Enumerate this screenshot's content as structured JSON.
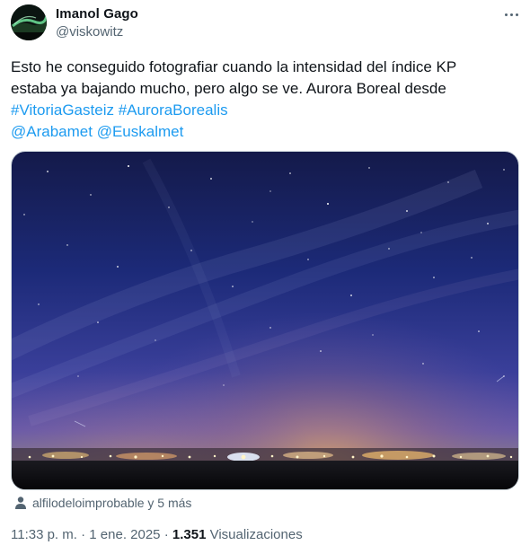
{
  "author": {
    "name": "Imanol Gago",
    "handle": "@viskowitz",
    "avatar_icon": "aurora-avatar"
  },
  "more_icon": "more-horizontal-icon",
  "tweet": {
    "line1": "Esto he conseguido fotografiar cuando la intensidad del índice KP",
    "line2": "estaba ya bajando mucho, pero algo se ve. Aurora Boreal desde",
    "hashtags": [
      "#VitoriaGasteiz",
      "#AuroraBorealis"
    ],
    "mentions": [
      "@Arabamet",
      "@Euskalmet"
    ]
  },
  "media": {
    "description_icon": "night-sky-aurora-photo"
  },
  "tagged": {
    "icon": "user-icon",
    "label": "alfilodeloimprobable y 5 más"
  },
  "meta": {
    "time": "11:33 p. m.",
    "separator": "·",
    "date": "1 ene. 2025",
    "views_count": "1.351",
    "views_label": "Visualizaciones"
  },
  "colors": {
    "link": "#1d9bf0",
    "secondary_text": "#536471",
    "primary_text": "#0f1419"
  }
}
